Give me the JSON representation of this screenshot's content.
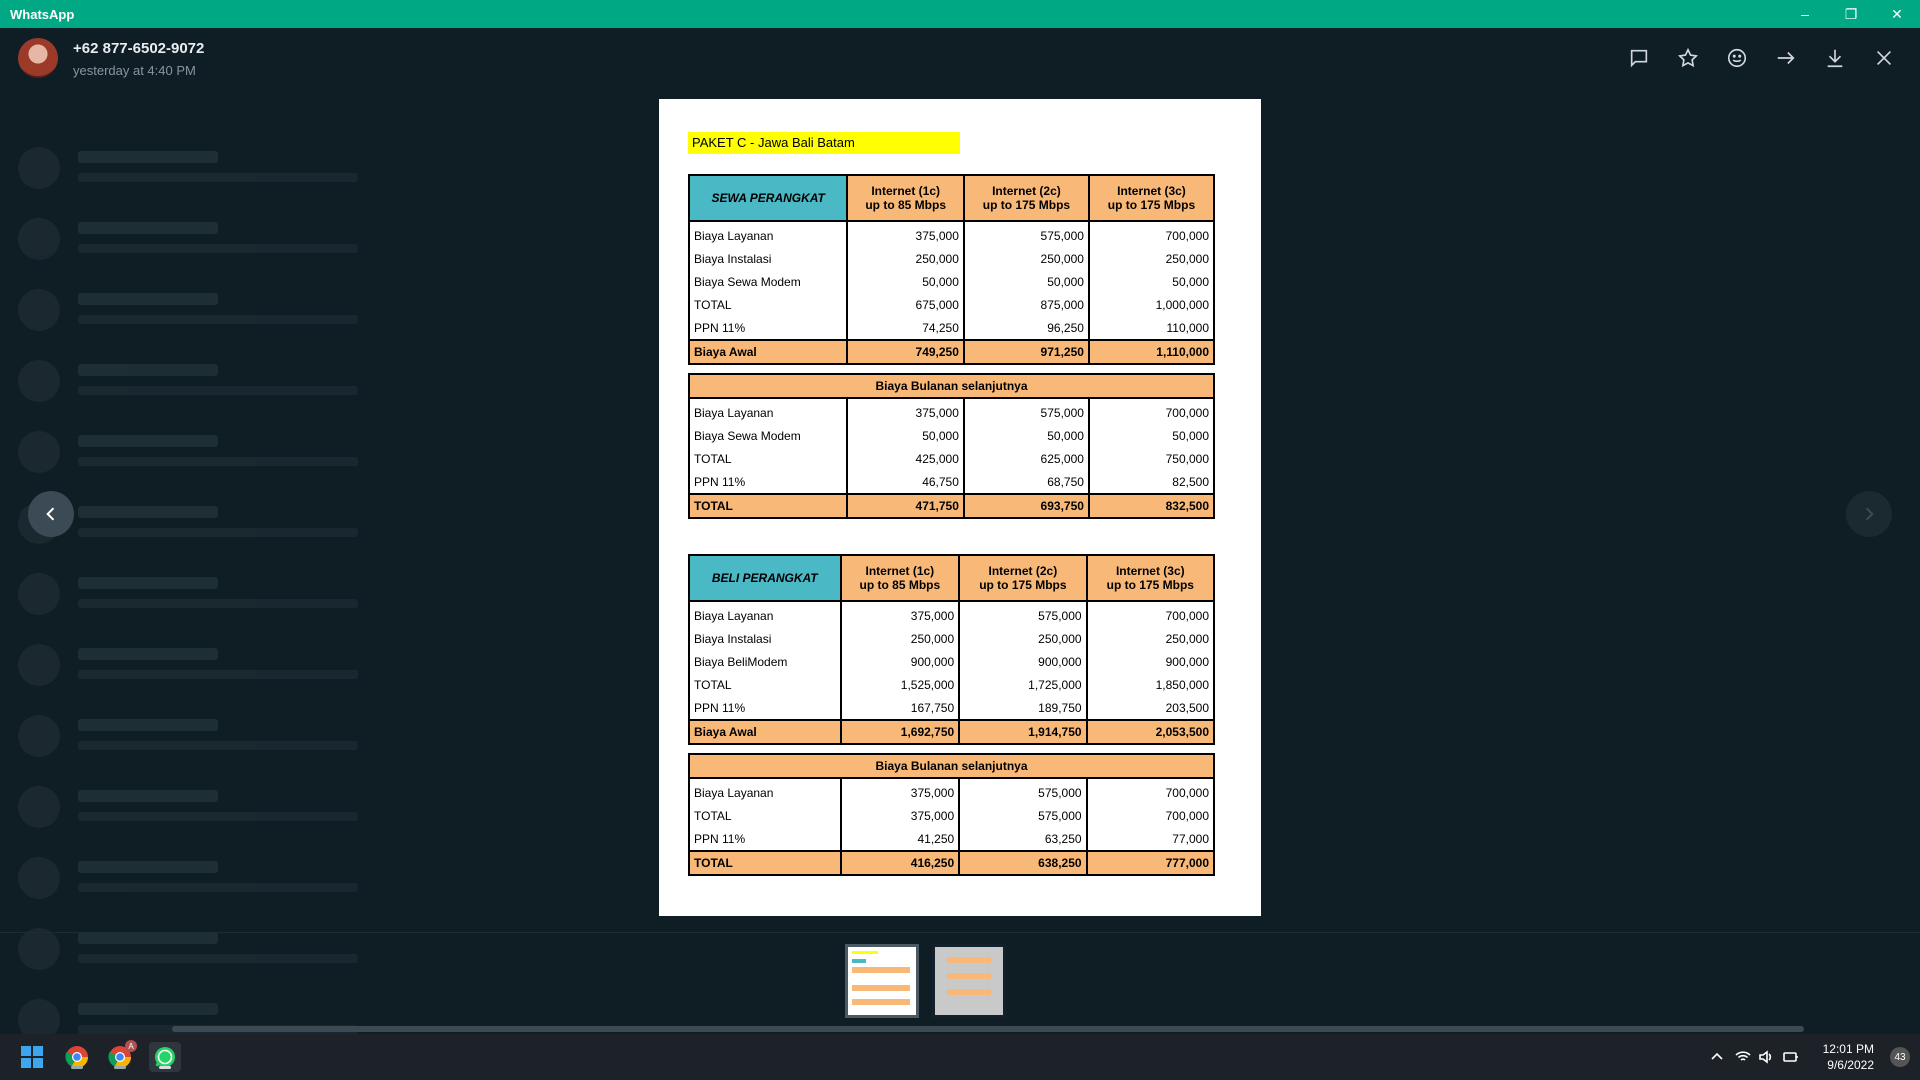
{
  "window": {
    "title": "WhatsApp",
    "controls": [
      "–",
      "❐",
      "✕"
    ]
  },
  "viewer": {
    "contact_name": "+62 877-6502-9072",
    "timestamp": "yesterday at 4:40 PM",
    "actions": [
      "reply-icon",
      "star-icon",
      "emoji-icon",
      "forward-icon",
      "download-icon",
      "close-icon"
    ]
  },
  "document": {
    "title": "PAKET C - Jawa Bali Batam",
    "columns": [
      "Internet (1c)\nup to 85 Mbps",
      "Internet (2c)\nup to 175 Mbps",
      "Internet (3c)\nup to 175 Mbps"
    ],
    "sewa": {
      "label": "SEWA PERANGKAT",
      "rows": [
        [
          "Biaya Layanan",
          "375,000",
          "575,000",
          "700,000"
        ],
        [
          "Biaya Instalasi",
          "250,000",
          "250,000",
          "250,000"
        ],
        [
          "Biaya Sewa Modem",
          "50,000",
          "50,000",
          "50,000"
        ],
        [
          "TOTAL",
          "675,000",
          "875,000",
          "1,000,000"
        ],
        [
          "PPN 11%",
          "74,250",
          "96,250",
          "110,000"
        ]
      ],
      "awal": [
        "Biaya Awal",
        "749,250",
        "971,250",
        "1,110,000"
      ],
      "monthly_label": "Biaya Bulanan selanjutnya",
      "monthly_rows": [
        [
          "Biaya Layanan",
          "375,000",
          "575,000",
          "700,000"
        ],
        [
          "Biaya Sewa Modem",
          "50,000",
          "50,000",
          "50,000"
        ],
        [
          "TOTAL",
          "425,000",
          "625,000",
          "750,000"
        ],
        [
          "PPN 11%",
          "46,750",
          "68,750",
          "82,500"
        ]
      ],
      "monthly_total": [
        "TOTAL",
        "471,750",
        "693,750",
        "832,500"
      ]
    },
    "beli": {
      "label": "BELI PERANGKAT",
      "rows": [
        [
          "Biaya Layanan",
          "375,000",
          "575,000",
          "700,000"
        ],
        [
          "Biaya Instalasi",
          "250,000",
          "250,000",
          "250,000"
        ],
        [
          "Biaya BeliModem",
          "900,000",
          "900,000",
          "900,000"
        ],
        [
          "TOTAL",
          "1,525,000",
          "1,725,000",
          "1,850,000"
        ],
        [
          "PPN 11%",
          "167,750",
          "189,750",
          "203,500"
        ]
      ],
      "awal": [
        "Biaya Awal",
        "1,692,750",
        "1,914,750",
        "2,053,500"
      ],
      "monthly_label": "Biaya Bulanan selanjutnya",
      "monthly_rows": [
        [
          "Biaya Layanan",
          "375,000",
          "575,000",
          "700,000"
        ],
        [
          "TOTAL",
          "375,000",
          "575,000",
          "700,000"
        ],
        [
          "PPN 11%",
          "41,250",
          "63,250",
          "77,000"
        ]
      ],
      "monthly_total": [
        "TOTAL",
        "416,250",
        "638,250",
        "777,000"
      ]
    }
  },
  "taskbar": {
    "apps": [
      "windows-start-icon",
      "chrome-icon",
      "chrome-profile-icon",
      "whatsapp-icon"
    ],
    "profile_badge": "A",
    "clock_time": "12:01 PM",
    "clock_date": "9/6/2022",
    "notification_count": "43"
  },
  "colors": {
    "accent": "#00a884",
    "cyan": "#4bb8c6",
    "orange": "#f8b878",
    "yellow": "#ffff00"
  }
}
